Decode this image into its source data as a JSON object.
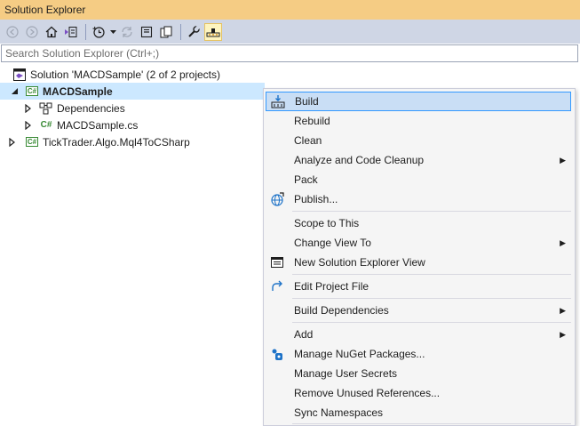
{
  "window": {
    "title": "Solution Explorer"
  },
  "toolbar": {
    "buttons": [
      "back-icon",
      "forward-icon",
      "home-icon",
      "switch-views-icon",
      "history-icon",
      "sync-icon",
      "collapse-all-icon",
      "show-all-files-icon",
      "properties-icon",
      "preview-selected-icon"
    ]
  },
  "search": {
    "placeholder": "Search Solution Explorer (Ctrl+;)"
  },
  "tree": {
    "solution": "Solution 'MACDSample' (2 of 2 projects)",
    "project1": "MACDSample",
    "dependencies": "Dependencies",
    "file1": "MACDSample.cs",
    "project2": "TickTrader.Algo.Mql4ToCSharp",
    "cs_badge": "C#"
  },
  "context_menu": {
    "build": "Build",
    "rebuild": "Rebuild",
    "clean": "Clean",
    "analyze": "Analyze and Code Cleanup",
    "pack": "Pack",
    "publish": "Publish...",
    "scope": "Scope to This",
    "change_view": "Change View To",
    "new_view": "New Solution Explorer View",
    "edit_project": "Edit Project File",
    "build_deps": "Build Dependencies",
    "add": "Add",
    "nuget": "Manage NuGet Packages...",
    "secrets": "Manage User Secrets",
    "remove_refs": "Remove Unused References...",
    "sync_ns": "Sync Namespaces"
  },
  "colors": {
    "title_bar": "#f5cc84",
    "toolbar": "#cfd6e5",
    "selection": "#cce8ff",
    "menu_highlight": "#c9def5",
    "accent": "#3399ff"
  }
}
